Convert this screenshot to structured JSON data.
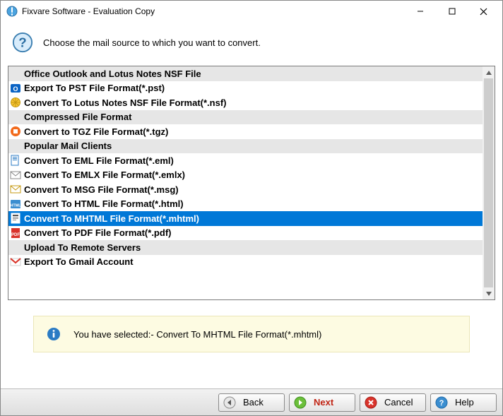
{
  "window": {
    "title": "Fixvare Software - Evaluation Copy"
  },
  "header": {
    "prompt": "Choose the mail source to which you want to convert."
  },
  "list": {
    "rows": [
      {
        "type": "header",
        "label": "Office Outlook and Lotus Notes NSF File"
      },
      {
        "type": "item",
        "icon": "outlook",
        "label": "Export To PST File Format(*.pst)"
      },
      {
        "type": "item",
        "icon": "lotus",
        "label": "Convert To Lotus Notes NSF File Format(*.nsf)"
      },
      {
        "type": "header",
        "label": "Compressed File Format"
      },
      {
        "type": "item",
        "icon": "tgz",
        "label": "Convert to TGZ File Format(*.tgz)"
      },
      {
        "type": "header",
        "label": "Popular Mail Clients"
      },
      {
        "type": "item",
        "icon": "eml",
        "label": "Convert To EML File Format(*.eml)"
      },
      {
        "type": "item",
        "icon": "emlx",
        "label": "Convert To EMLX File Format(*.emlx)"
      },
      {
        "type": "item",
        "icon": "msg",
        "label": "Convert To MSG File Format(*.msg)"
      },
      {
        "type": "item",
        "icon": "html",
        "label": "Convert To HTML File Format(*.html)"
      },
      {
        "type": "item",
        "icon": "mhtml",
        "label": "Convert To MHTML File Format(*.mhtml)",
        "selected": true
      },
      {
        "type": "item",
        "icon": "pdf",
        "label": "Convert To PDF File Format(*.pdf)"
      },
      {
        "type": "header",
        "label": "Upload To Remote Servers"
      },
      {
        "type": "item",
        "icon": "gmail",
        "label": "Export To Gmail Account"
      }
    ]
  },
  "notice": {
    "message": "You have selected:- Convert To MHTML File Format(*.mhtml)"
  },
  "buttons": {
    "back": "Back",
    "next": "Next",
    "cancel": "Cancel",
    "help": "Help"
  }
}
